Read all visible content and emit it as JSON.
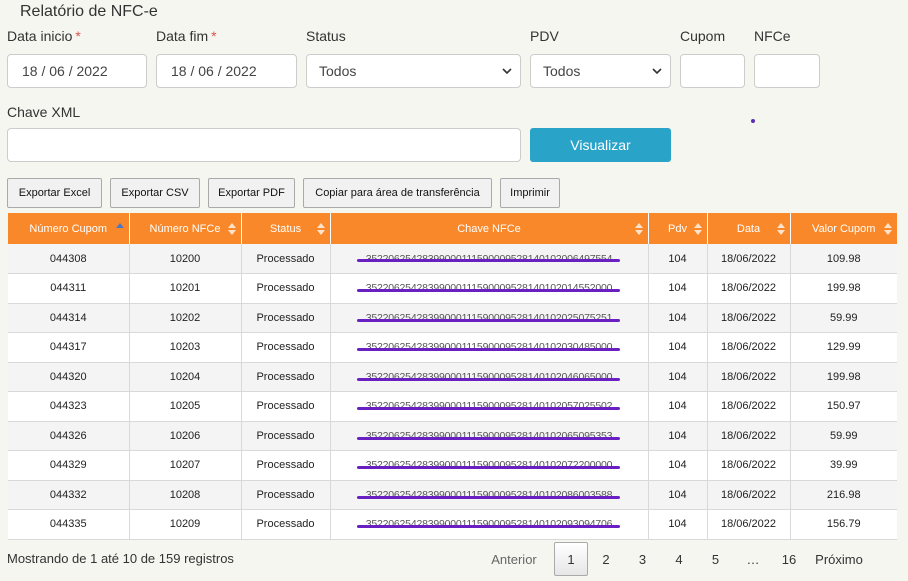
{
  "page": {
    "title": "Relatório de NFC-e"
  },
  "filters": {
    "data_inicio_label": "Data inicio",
    "data_inicio_value": "18 / 06 / 2022",
    "data_fim_label": "Data fim",
    "data_fim_value": "18 / 06 / 2022",
    "required_mark": "*",
    "status_label": "Status",
    "status_value": "Todos",
    "pdv_label": "PDV",
    "pdv_value": "Todos",
    "cupom_label": "Cupom",
    "cupom_value": "",
    "nfce_label": "NFCe",
    "nfce_value": "",
    "chave_label": "Chave XML",
    "chave_value": "",
    "visualizar_label": "Visualizar"
  },
  "toolbar": {
    "excel": "Exportar Excel",
    "csv": "Exportar CSV",
    "pdf": "Exportar PDF",
    "copy": "Copiar para área de transferência",
    "print": "Imprimir"
  },
  "table": {
    "headers": [
      "Número Cupom",
      "Número NFCe",
      "Status",
      "Chave NFCe",
      "Pdv",
      "Data",
      "Valor Cupom"
    ],
    "rows": [
      [
        "044308",
        "10200",
        "Processado",
        "35220625428399000111590009528140102006497554",
        "104",
        "18/06/2022",
        "109.98"
      ],
      [
        "044311",
        "10201",
        "Processado",
        "35220625428399000111590009528140102014552000",
        "104",
        "18/06/2022",
        "199.98"
      ],
      [
        "044314",
        "10202",
        "Processado",
        "35220625428399000111590009528140102025075251",
        "104",
        "18/06/2022",
        "59.99"
      ],
      [
        "044317",
        "10203",
        "Processado",
        "35220625428399000111590009528140102030485000",
        "104",
        "18/06/2022",
        "129.99"
      ],
      [
        "044320",
        "10204",
        "Processado",
        "35220625428399000111590009528140102046065000",
        "104",
        "18/06/2022",
        "199.98"
      ],
      [
        "044323",
        "10205",
        "Processado",
        "35220625428399000111590009528140102057025502",
        "104",
        "18/06/2022",
        "150.97"
      ],
      [
        "044326",
        "10206",
        "Processado",
        "35220625428399000111590009528140102065095353",
        "104",
        "18/06/2022",
        "59.99"
      ],
      [
        "044329",
        "10207",
        "Processado",
        "35220625428399000111590009528140102072200000",
        "104",
        "18/06/2022",
        "39.99"
      ],
      [
        "044332",
        "10208",
        "Processado",
        "35220625428399000111590009528140102086003588",
        "104",
        "18/06/2022",
        "216.98"
      ],
      [
        "044335",
        "10209",
        "Processado",
        "35220625428399000111590009528140102093094706",
        "104",
        "18/06/2022",
        "156.79"
      ]
    ]
  },
  "footer": {
    "info": "Mostrando de 1 até 10 de 159 registros",
    "prev": "Anterior",
    "pages": [
      "1",
      "2",
      "3",
      "4",
      "5",
      "…",
      "16"
    ],
    "next": "Próximo"
  },
  "colors": {
    "header": "#f9882a",
    "primary": "#2aa3c9",
    "strike": "#6a1fc2"
  }
}
